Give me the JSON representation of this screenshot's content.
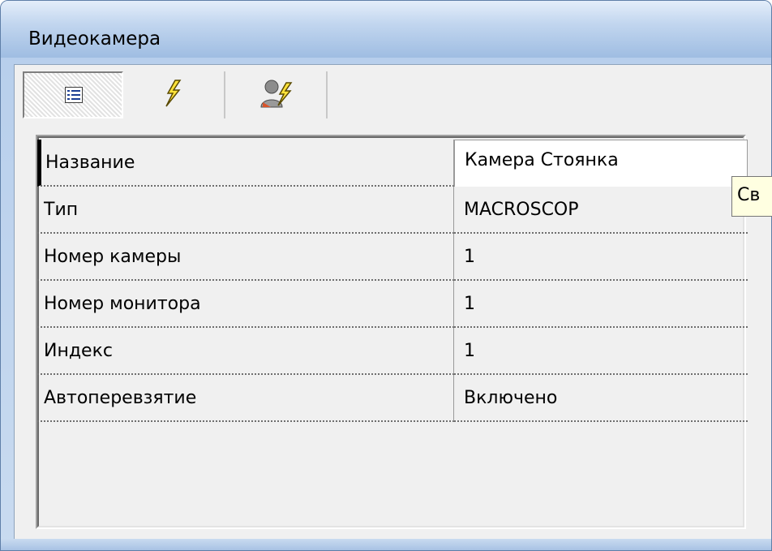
{
  "window": {
    "title": "Видеокамера"
  },
  "toolbar": {
    "buttons": [
      {
        "icon": "properties-list-icon",
        "active": true
      },
      {
        "icon": "events-lightning-icon",
        "active": false
      },
      {
        "icon": "user-events-icon",
        "active": false
      }
    ]
  },
  "properties": [
    {
      "name": "Название",
      "value": "Камера Стоянка"
    },
    {
      "name": "Тип",
      "value": "MACROSCOP"
    },
    {
      "name": "Номер камеры",
      "value": "1"
    },
    {
      "name": "Номер монитора",
      "value": "1"
    },
    {
      "name": "Индекс",
      "value": "1"
    },
    {
      "name": "Автоперевзятие",
      "value": "Включено"
    }
  ],
  "tooltip": {
    "text": "Св"
  }
}
